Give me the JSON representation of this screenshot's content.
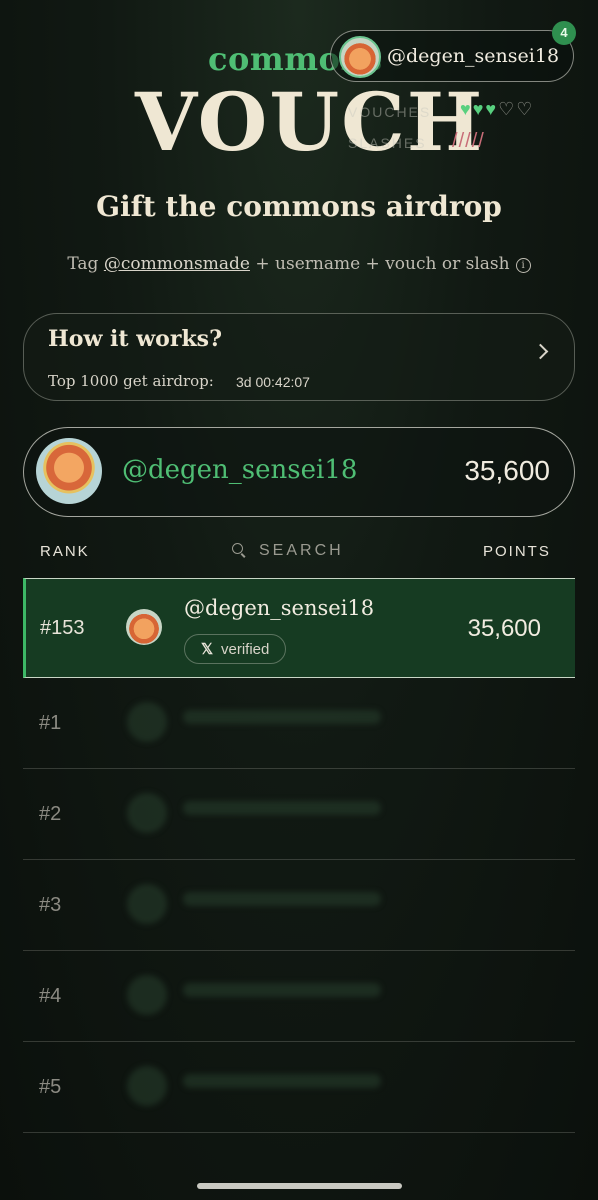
{
  "header": {
    "brand": "commons",
    "app_title": "VOUCH",
    "username": "@degen_sensei18",
    "notification_count": "4",
    "vouches_label": "VOUCHES",
    "slashes_label": "SLASHES",
    "vouches_filled": 3,
    "vouches_total": 5,
    "slashes_used": 5
  },
  "hero": {
    "headline": "Gift the commons airdrop",
    "tagline_prefix": "Tag ",
    "tagline_mention": "@commonsmade",
    "tagline_suffix": " + username + vouch or slash"
  },
  "how_card": {
    "title": "How it works?",
    "subtitle": "Top 1000 get airdrop:",
    "countdown": "3d 00:42:07"
  },
  "me": {
    "handle": "@degen_sensei18",
    "points": "35,600"
  },
  "table": {
    "col_rank": "RANK",
    "search_label": "SEARCH",
    "col_points": "POINTS",
    "my_row": {
      "rank": "#153",
      "handle": "@degen_sensei18",
      "badge": "verified",
      "points": "35,600"
    },
    "rows": [
      {
        "rank": "#1"
      },
      {
        "rank": "#2"
      },
      {
        "rank": "#3"
      },
      {
        "rank": "#4"
      },
      {
        "rank": "#5"
      }
    ]
  },
  "colors": {
    "accent_green": "#4fbe74",
    "highlight_row": "#163b22",
    "slash_red": "#c86d78"
  }
}
